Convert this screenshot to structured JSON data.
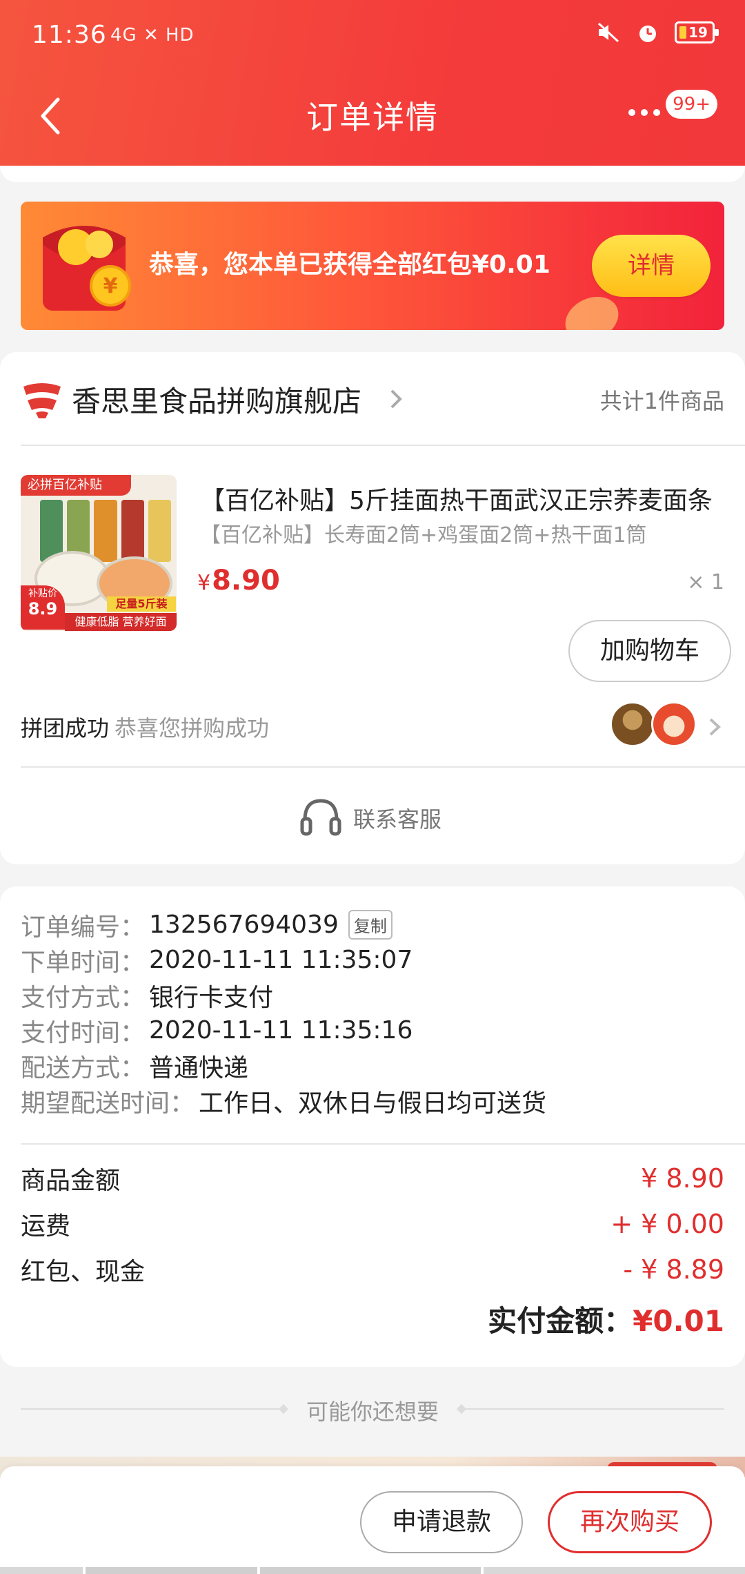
{
  "status_bar": {
    "time": "11:36",
    "network": "4G ✕ HD",
    "battery": "19"
  },
  "nav": {
    "title": "订单详情",
    "more_badge": "99+"
  },
  "banner": {
    "text": "恭喜，您本单已获得全部红包¥0.01",
    "button": "详情"
  },
  "shop": {
    "name": "香思里食品拼购旗舰店",
    "item_count": "共计1件商品"
  },
  "product": {
    "image_label": "必拼百亿补贴",
    "image_price_label": "补贴价",
    "image_price": "8.9",
    "image_tag": "足量5斤装",
    "image_footer": "健康低脂 营养好面",
    "title": "【百亿补贴】5斤挂面热干面武汉正宗荞麦面条",
    "spec": "【百亿补贴】长寿面2筒+鸡蛋面2筒+热干面1筒",
    "currency": "¥",
    "price": "8.90",
    "quantity": "× 1",
    "cart_button": "加购物车"
  },
  "group": {
    "status": "拼团成功",
    "note": "恭喜您拼购成功"
  },
  "service": {
    "label": "联系客服"
  },
  "order_info": [
    {
      "key": "订单编号：",
      "value": "132567694039",
      "action": "复制"
    },
    {
      "key": "下单时间：",
      "value": "2020-11-11 11:35:07"
    },
    {
      "key": "支付方式：",
      "value": "银行卡支付"
    },
    {
      "key": "支付时间：",
      "value": "2020-11-11 11:35:16"
    },
    {
      "key": "配送方式：",
      "value": "普通快递"
    },
    {
      "key": "期望配送时间：",
      "value": "工作日、双休日与假日均可送货"
    }
  ],
  "money": [
    {
      "label": "商品金额",
      "value": "¥ 8.90"
    },
    {
      "label": "运费",
      "value": "+ ¥ 0.00"
    },
    {
      "label": "红包、现金",
      "value": "- ¥ 8.89"
    }
  ],
  "total": {
    "label": "实付金额：",
    "value": "¥0.01"
  },
  "recommend": {
    "label": "可能你还想要"
  },
  "bottom": {
    "refund": "申请退款",
    "rebuy": "再次购买"
  },
  "colors": {
    "brand_red": "#f43b3b",
    "price_red": "#e02e2e",
    "gold": "#ffc61f"
  }
}
